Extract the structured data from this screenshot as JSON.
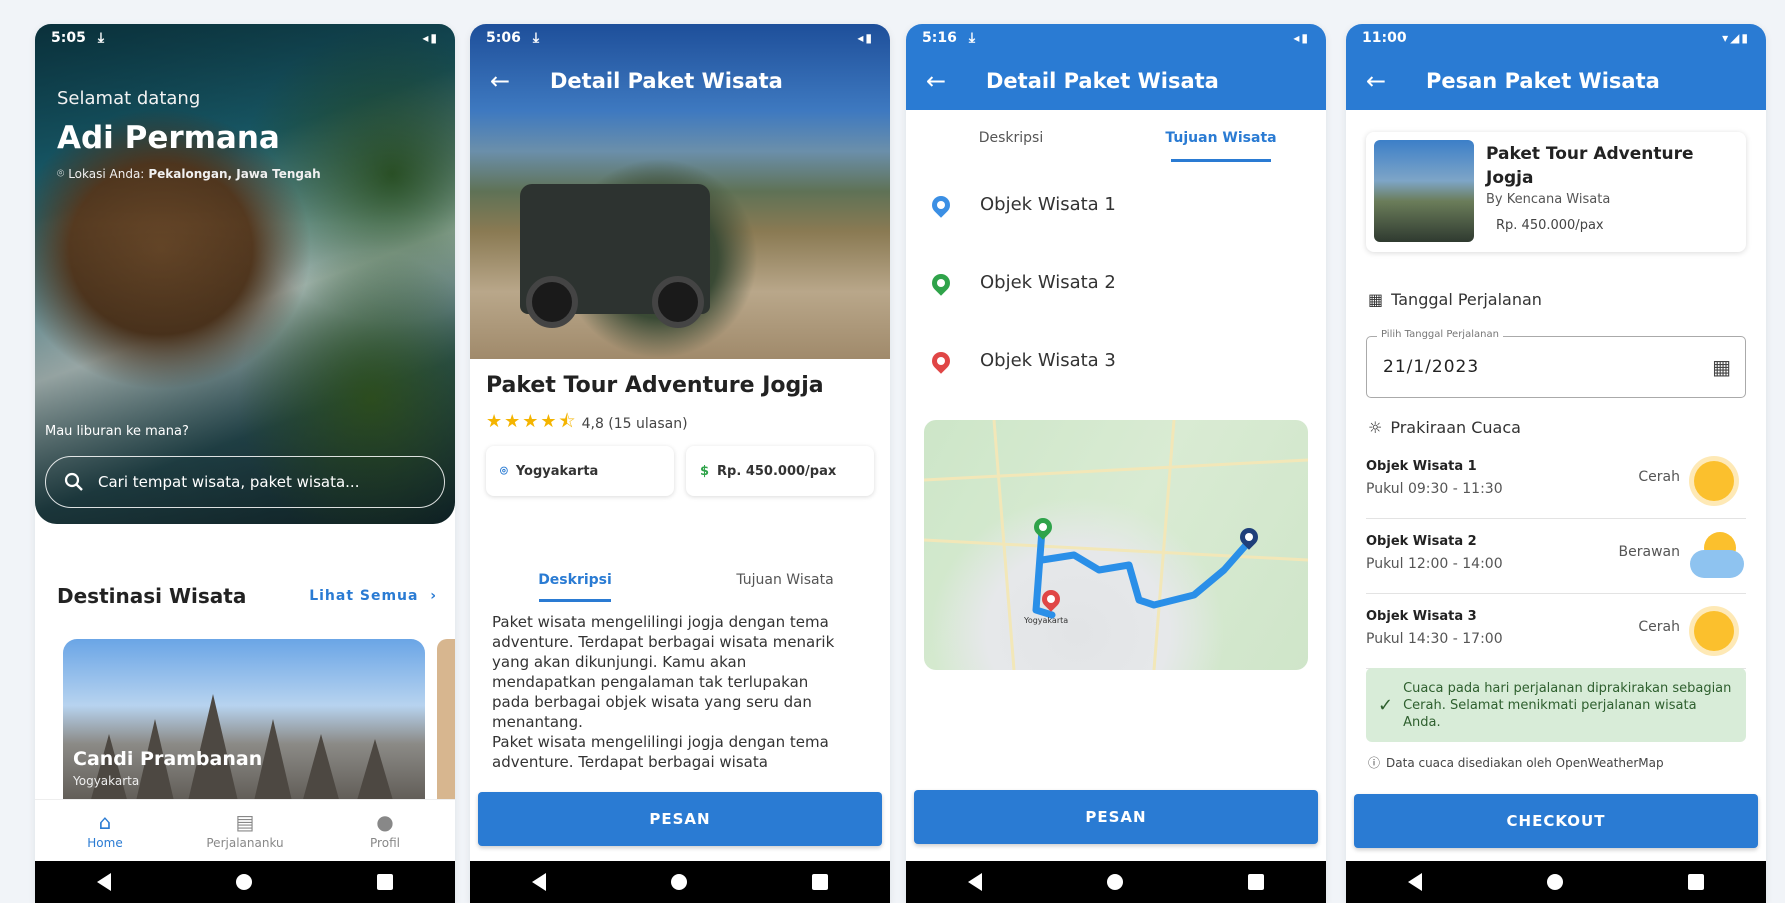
{
  "colors": {
    "primary": "#2a7bd3",
    "star": "#f4b400",
    "pin_blue": "#3b8fe4",
    "pin_green": "#2fa34a",
    "pin_red": "#e04646",
    "route": "#2a8fe8"
  },
  "screen1": {
    "status": {
      "time": "5:05"
    },
    "greeting": "Selamat datang",
    "user_name": "Adi Permana",
    "location_prefix": "Lokasi Anda:",
    "location_value": "Pekalongan, Jawa Tengah",
    "search_prompt": "Mau liburan ke mana?",
    "search_placeholder": "Cari tempat wisata, paket wisata...",
    "section_title": "Destinasi Wisata",
    "see_all": "Lihat Semua",
    "destination": {
      "name": "Candi Prambanan",
      "region": "Yogyakarta"
    },
    "bottom_nav": [
      {
        "label": "Home",
        "icon": "home-icon"
      },
      {
        "label": "Perjalananku",
        "icon": "journal-icon"
      },
      {
        "label": "Profil",
        "icon": "person-icon"
      }
    ]
  },
  "screen2": {
    "status": {
      "time": "5:06"
    },
    "title": "Detail Paket Wisata",
    "package_name": "Paket Tour Adventure Jogja",
    "rating": 4.8,
    "rating_text": "4,8 (15 ulasan)",
    "location": "Yogyakarta",
    "price": "Rp. 450.000/pax",
    "tabs": [
      "Deskripsi",
      "Tujuan Wisata"
    ],
    "description": [
      "Paket wisata mengelilingi jogja dengan tema adventure. Terdapat berbagai wisata menarik yang akan dikunjungi. Kamu akan mendapatkan pengalaman tak terlupakan pada berbagai objek wisata yang seru dan menantang.",
      "Paket wisata mengelilingi jogja dengan tema adventure. Terdapat berbagai wisata"
    ],
    "button": "PESAN"
  },
  "screen3": {
    "status": {
      "time": "5:16"
    },
    "title": "Detail Paket Wisata",
    "tabs": [
      "Deskripsi",
      "Tujuan Wisata"
    ],
    "destinations": [
      "Objek Wisata 1",
      "Objek Wisata 2",
      "Objek Wisata 3"
    ],
    "map_label": "Yogyakarta",
    "button": "PESAN"
  },
  "screen4": {
    "status": {
      "time": "11:00"
    },
    "title": "Pesan Paket Wisata",
    "package": {
      "name": "Paket Tour Adventure Jogja",
      "by": "By Kencana Wisata",
      "price": "Rp. 450.000/pax"
    },
    "date_section": "Tanggal Perjalanan",
    "date_legend": "Pilih Tanggal Perjalanan",
    "date_value": "21/1/2023",
    "weather_section": "Prakiraan Cuaca",
    "weather": [
      {
        "name": "Objek Wisata 1",
        "time": "Pukul 09:30 - 11:30",
        "condition": "Cerah"
      },
      {
        "name": "Objek Wisata 2",
        "time": "Pukul 12:00 - 14:00",
        "condition": "Berawan"
      },
      {
        "name": "Objek Wisata 3",
        "time": "Pukul 14:30 - 17:00",
        "condition": "Cerah"
      }
    ],
    "info": "Cuaca pada hari perjalanan diprakirakan sebagian Cerah. Selamat menikmati perjalanan wisata Anda.",
    "credit": "Data cuaca disediakan oleh OpenWeatherMap",
    "button": "CHECKOUT"
  }
}
